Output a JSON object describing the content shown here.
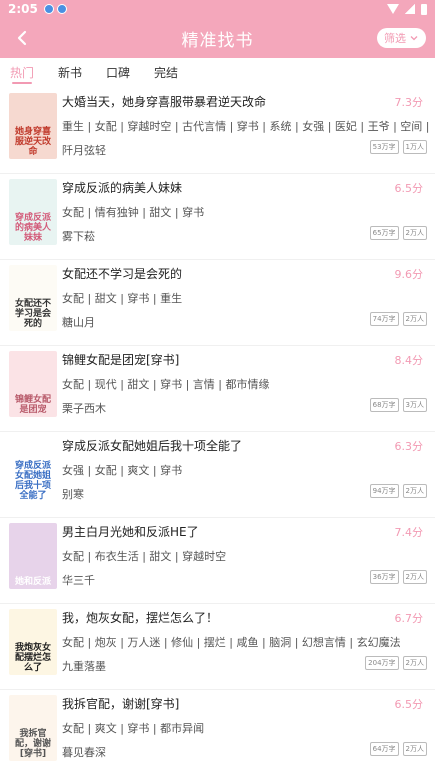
{
  "status_bar": {
    "time": "2:05"
  },
  "app_bar": {
    "title": "精准找书",
    "filter_label": "筛选"
  },
  "tabs": [
    "热门",
    "新书",
    "口碑",
    "完结"
  ],
  "books": [
    {
      "title": "大婚当天，她身穿喜服带暴君逆天改命",
      "score": "7.3分",
      "tags": "重生 | 女配 | 穿越时空 | 古代言情 | 穿书 | 系统 | 女强 | 医妃 | 王爷 | 空间 | 甜爽 | 腹黑",
      "author": "阡月弦轻",
      "words": "53万字",
      "readers": "1万人",
      "cover_text": "她身穿喜服逆天改命",
      "cover_bg": "#f6d9d0",
      "cover_fg": "#c0392b"
    },
    {
      "title": "穿成反派的病美人妹妹",
      "score": "6.5分",
      "tags": "女配 | 情有独钟 | 甜文 | 穿书",
      "author": "雾下菘",
      "words": "65万字",
      "readers": "2万人",
      "cover_text": "穿成反派的病美人妹妹",
      "cover_bg": "#e8f4f2",
      "cover_fg": "#d35b7a"
    },
    {
      "title": "女配还不学习是会死的",
      "score": "9.6分",
      "tags": "女配 | 甜文 | 穿书 | 重生",
      "author": "糖山月",
      "words": "74万字",
      "readers": "2万人",
      "cover_text": "女配还不学习是会死的",
      "cover_bg": "#fdfbf5",
      "cover_fg": "#333333"
    },
    {
      "title": "锦鲤女配是团宠[穿书]",
      "score": "8.4分",
      "tags": "女配 | 现代 | 甜文 | 穿书 | 言情 | 都市情缘",
      "author": "栗子西木",
      "words": "68万字",
      "readers": "3万人",
      "cover_text": "锦鲤女配是团宠",
      "cover_bg": "#fbe3e6",
      "cover_fg": "#b85a6a"
    },
    {
      "title": "穿成反派女配她姐后我十项全能了",
      "score": "6.3分",
      "tags": "女强 | 女配 | 爽文 | 穿书",
      "author": "别寒",
      "words": "94万字",
      "readers": "2万人",
      "cover_text": "穿成反派女配她姐后我十项全能了",
      "cover_bg": "#ffffff",
      "cover_fg": "#3a6fc4"
    },
    {
      "title": "男主白月光她和反派HE了",
      "score": "7.4分",
      "tags": "女配 | 布衣生活 | 甜文 | 穿越时空",
      "author": "华三千",
      "words": "36万字",
      "readers": "2万人",
      "cover_text": "她和反派",
      "cover_bg": "#e7d3ea",
      "cover_fg": "#ffffff"
    },
    {
      "title": "我，炮灰女配，摆烂怎么了！",
      "score": "6.7分",
      "tags": "女配 | 炮灰 | 万人迷 | 修仙 | 摆烂 | 咸鱼 | 脑洞 | 幻想言情 | 玄幻魔法",
      "author": "九重落墨",
      "words": "204万字",
      "readers": "2万人",
      "cover_text": "我炮灰女配摆烂怎么了",
      "cover_bg": "#fdf6e3",
      "cover_fg": "#222222"
    },
    {
      "title": "我拆官配，谢谢[穿书]",
      "score": "6.5分",
      "tags": "女配 | 爽文 | 穿书 | 都市异闻",
      "author": "暮见春深",
      "words": "64万字",
      "readers": "2万人",
      "cover_text": "我拆官配，谢谢[穿书]",
      "cover_bg": "#fdf5ec",
      "cover_fg": "#555555"
    }
  ],
  "colors": {
    "brand": "#f4a7bb",
    "accent": "#f29ab3"
  }
}
